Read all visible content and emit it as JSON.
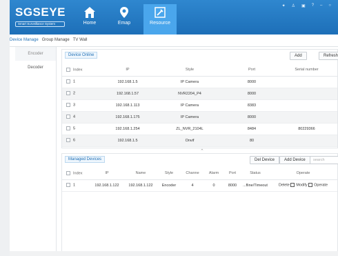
{
  "header": {
    "brand": "SGSEYE",
    "subtitle": "Smart Surveillance System",
    "nav": [
      {
        "label": "Home",
        "icon": "home-icon"
      },
      {
        "label": "Emap",
        "icon": "map-pin-icon"
      },
      {
        "label": "Resource",
        "icon": "wrench-icon"
      }
    ],
    "system_icons": [
      "pin-icon",
      "user-icon",
      "lock-icon",
      "help-icon",
      "minimize-icon",
      "close-icon"
    ],
    "colors": {
      "bar": "#1d6fb8",
      "active": "#4aa6ec"
    }
  },
  "tabs": [
    "Device Manage",
    "Group Manage",
    "TV Wall"
  ],
  "sidebar": [
    "Encoder",
    "Decoder"
  ],
  "online": {
    "title": "Device Online",
    "add_label": "Add",
    "refresh_label": "Refresh",
    "columns": [
      "Index",
      "IP",
      "Style",
      "Port",
      "Serial number"
    ],
    "rows": [
      [
        "1",
        "192.168.1.5",
        "IP Camera",
        "8000",
        ""
      ],
      [
        "2",
        "192.168.1.57",
        "NVR2204_P4",
        "8000",
        ""
      ],
      [
        "3",
        "192.168.1.113",
        "IP Camera",
        "8383",
        ""
      ],
      [
        "4",
        "192.168.1.175",
        "IP Camera",
        "8000",
        ""
      ],
      [
        "5",
        "192.168.1.254",
        "ZL_NVR_2104L",
        "8484",
        "80229366"
      ],
      [
        "6",
        "192.168.1.5",
        "Onvif",
        "80",
        ""
      ]
    ]
  },
  "managed": {
    "title": "Managed Devices",
    "del_label": "Del Device",
    "add_label": "Add Device",
    "search_placeholder": "search",
    "columns": [
      "Index",
      "IP",
      "Name",
      "Style",
      "Channe",
      "Alarm",
      "Port",
      "Status",
      "Operate"
    ],
    "rows": [
      {
        "index": "1",
        "ip": "192.168.1.122",
        "name": "192.168.1.122",
        "style": "Encoder",
        "channel": "4",
        "alarm": "0",
        "port": "8000",
        "status": "...fline/Timeout",
        "op_delete": "Delete",
        "op_modify": "Modify",
        "op_operate": "Operate"
      }
    ]
  }
}
